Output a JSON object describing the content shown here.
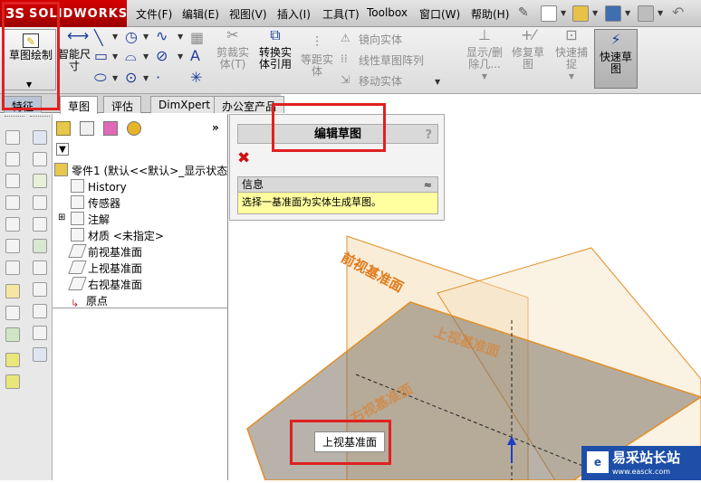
{
  "app": {
    "logo_ds": "3S",
    "logo_name": "SOLIDWORKS"
  },
  "menus": [
    "文件(F)",
    "编辑(E)",
    "视图(V)",
    "插入(I)",
    "工具(T)",
    "Toolbox",
    "窗口(W)",
    "帮助(H)"
  ],
  "ribbon": {
    "sketch": "草图绘制",
    "smart_dim_1": "智能尺",
    "smart_dim_2": "寸",
    "trim_1": "剪裁实",
    "trim_2": "体(T)",
    "convert_1": "转换实",
    "convert_2": "体引用",
    "offset_1": "等距实",
    "offset_2": "体",
    "mirror": "镜向实体",
    "pattern": "线性草图阵列",
    "move": "移动实体",
    "display_1": "显示/删",
    "display_2": "除几...",
    "repair_1": "修复草",
    "repair_2": "图",
    "quick_snap_1": "快速捕",
    "quick_snap_2": "捉",
    "rapid_sketch_1": "快速草",
    "rapid_sketch_2": "图"
  },
  "tabs": [
    "特征",
    "草图",
    "评估",
    "DimXpert",
    "办公室产品"
  ],
  "tree": {
    "root": "零件1 (默认<<默认>_显示状态",
    "items": [
      "History",
      "传感器",
      "注解",
      "材质 <未指定>",
      "前视基准面",
      "上视基准面",
      "右视基准面",
      "原点"
    ]
  },
  "property_manager": {
    "title": "编辑草图",
    "help": "?",
    "info_title": "信息",
    "info_text": "选择一基准面为实体生成草图。"
  },
  "viewport": {
    "front_plane": "前视基准面",
    "top_plane": "上视基准面",
    "right_plane": "右视基准面",
    "tooltip": "上视基准面"
  },
  "watermark": {
    "text": "易采站长站",
    "sub": "www.easck.com"
  },
  "colors": {
    "highlight": "#e02020",
    "plane": "#f0a030",
    "info_bg": "#ffffa0"
  }
}
